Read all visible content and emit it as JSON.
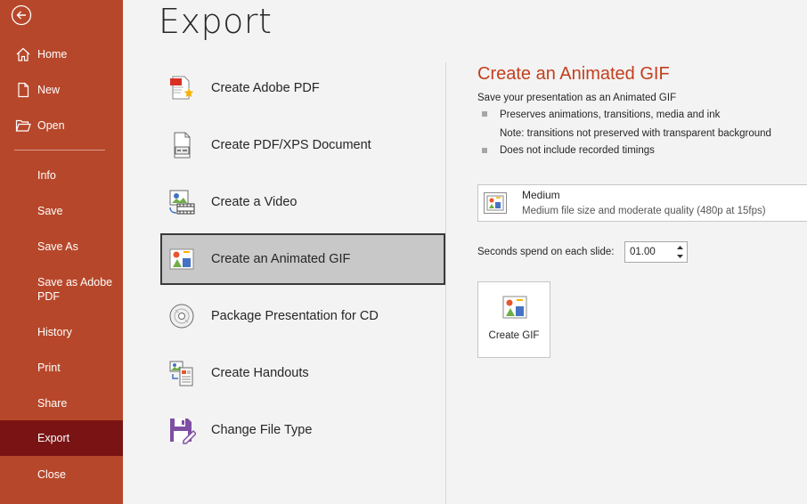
{
  "sidebar": {
    "back_icon": "back-arrow-icon",
    "items": [
      {
        "label": "Home",
        "icon": "home-icon"
      },
      {
        "label": "New",
        "icon": "new-document-icon"
      },
      {
        "label": "Open",
        "icon": "folder-open-icon"
      },
      {
        "label": "Info"
      },
      {
        "label": "Save"
      },
      {
        "label": "Save As"
      },
      {
        "label": "Save as Adobe PDF"
      },
      {
        "label": "History"
      },
      {
        "label": "Print"
      },
      {
        "label": "Share"
      },
      {
        "label": "Export",
        "selected": true
      },
      {
        "label": "Close"
      }
    ],
    "colors": {
      "background": "#b7472a",
      "selected": "#7a1414"
    }
  },
  "main": {
    "title": "Export",
    "options": [
      {
        "label": "Create Adobe PDF",
        "icon": "adobe-pdf-icon"
      },
      {
        "label": "Create PDF/XPS Document",
        "icon": "pdf-xps-icon"
      },
      {
        "label": "Create a Video",
        "icon": "video-icon"
      },
      {
        "label": "Create an Animated GIF",
        "icon": "animated-gif-icon",
        "selected": true
      },
      {
        "label": "Package Presentation for CD",
        "icon": "cd-icon"
      },
      {
        "label": "Create Handouts",
        "icon": "handouts-icon"
      },
      {
        "label": "Change File Type",
        "icon": "change-file-type-icon"
      }
    ]
  },
  "panel": {
    "title": "Create an Animated GIF",
    "subtitle": "Save your presentation as an Animated GIF",
    "bullets": [
      "Preserves animations, transitions, media and ink",
      "Does not include recorded timings"
    ],
    "note": "Note: transitions not preserved with transparent background",
    "quality": {
      "title": "Medium",
      "description": "Medium file size and moderate quality (480p at 15fps)",
      "icon": "quality-icon"
    },
    "seconds_label": "Seconds spend on each slide:",
    "seconds_value": "01.00",
    "create_button": "Create GIF",
    "accent_color": "#c43e1c"
  }
}
